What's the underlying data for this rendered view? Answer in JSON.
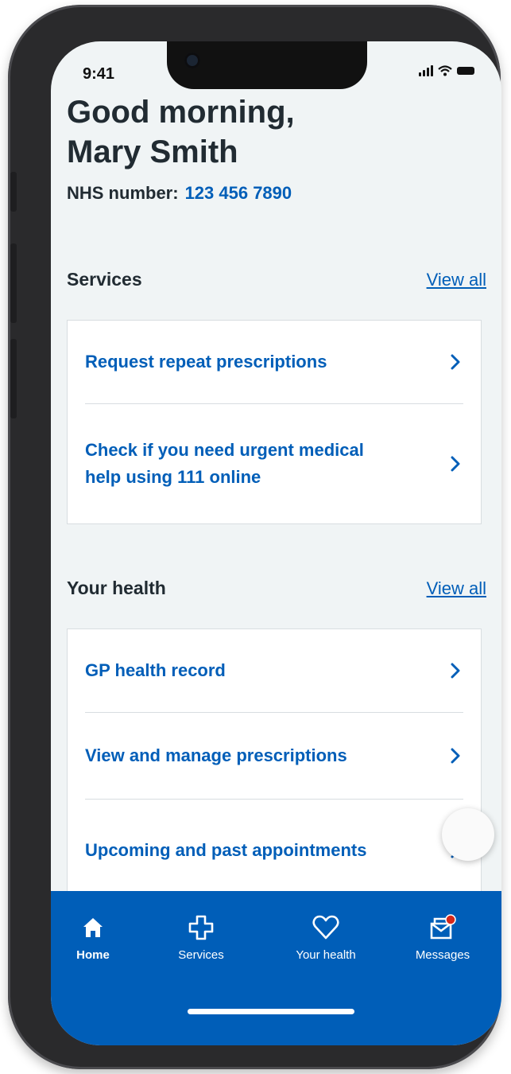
{
  "status": {
    "time": "9:41"
  },
  "greeting": {
    "line1": "Good morning,",
    "line2": "Mary Smith"
  },
  "nhs": {
    "label": "NHS number:",
    "value": "123 456 7890"
  },
  "services": {
    "title": "Services",
    "view_all": "View all",
    "items": [
      {
        "label": "Request repeat prescriptions"
      },
      {
        "label": "Check if you need urgent medical help using 111 online"
      }
    ]
  },
  "your_health": {
    "title": "Your health",
    "view_all": "View all",
    "items": [
      {
        "label": "GP health record"
      },
      {
        "label": "View and manage prescriptions"
      },
      {
        "label": "Upcoming and past appointments"
      }
    ]
  },
  "tabbar": {
    "tabs": [
      {
        "label": "Home",
        "icon": "home-icon",
        "active": true
      },
      {
        "label": "Services",
        "icon": "plus-icon",
        "active": false
      },
      {
        "label": "Your health",
        "icon": "heart-icon",
        "active": false
      },
      {
        "label": "Messages",
        "icon": "message-icon",
        "active": false
      }
    ]
  },
  "colors": {
    "nhs_blue": "#005eb8",
    "text": "#212b32",
    "background": "#f0f4f5",
    "notification_dot": "#d5281b"
  }
}
